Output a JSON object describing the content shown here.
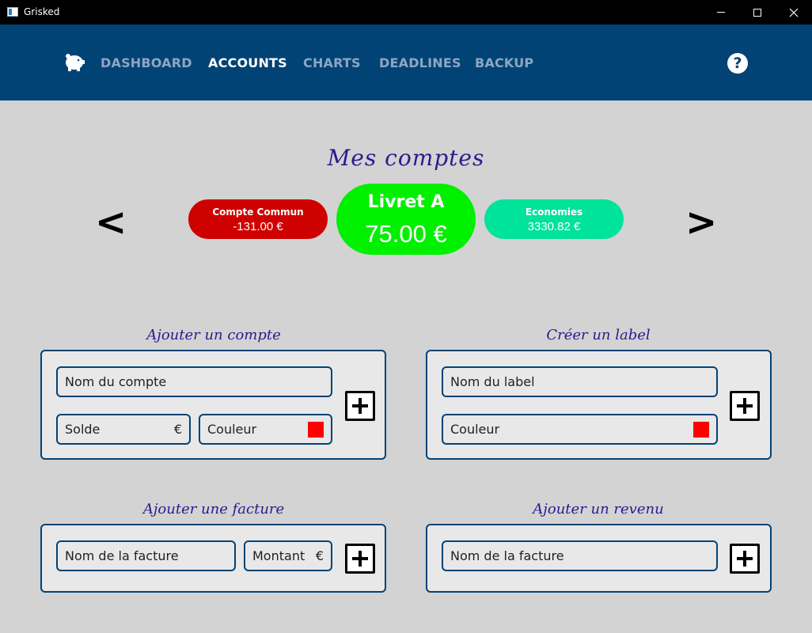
{
  "window": {
    "title": "Grisked"
  },
  "nav": {
    "logo_icon": "piggy-bank-icon",
    "items": [
      {
        "label": "DASHBOARD",
        "active": false
      },
      {
        "label": "ACCOUNTS",
        "active": true
      },
      {
        "label": "CHARTS",
        "active": false
      },
      {
        "label": "DEADLINES",
        "active": false
      },
      {
        "label": "BACKUP",
        "active": false
      }
    ],
    "help_label": "?"
  },
  "colors": {
    "header": "#024375",
    "background": "#d3d3d3",
    "accent_title": "#2b1b8e",
    "nav_inactive": "#8ea6c4"
  },
  "accounts": {
    "title": "Mes comptes",
    "prev_label": "<",
    "next_label": ">",
    "left": {
      "name": "Compte Commun",
      "balance": "-131.00 €",
      "color": "#cf0000"
    },
    "center": {
      "name": "Livret A",
      "balance": "75.00 €",
      "color": "#00f000"
    },
    "right": {
      "name": "Economies",
      "balance": "3330.82 €",
      "color": "#00e39a"
    }
  },
  "add_account": {
    "title": "Ajouter un compte",
    "name_placeholder": "Nom du compte",
    "balance_placeholder": "Solde",
    "balance_suffix": "€",
    "color_placeholder": "Couleur",
    "color_value": "#ff0000"
  },
  "create_label": {
    "title": "Créer un label",
    "name_placeholder": "Nom du label",
    "color_placeholder": "Couleur",
    "color_value": "#ff0000"
  },
  "add_bill": {
    "title": "Ajouter une facture",
    "name_placeholder": "Nom de la facture",
    "amount_placeholder": "Montant",
    "amount_suffix": "€"
  },
  "add_income": {
    "title": "Ajouter un revenu",
    "name_placeholder": "Nom de la facture"
  }
}
